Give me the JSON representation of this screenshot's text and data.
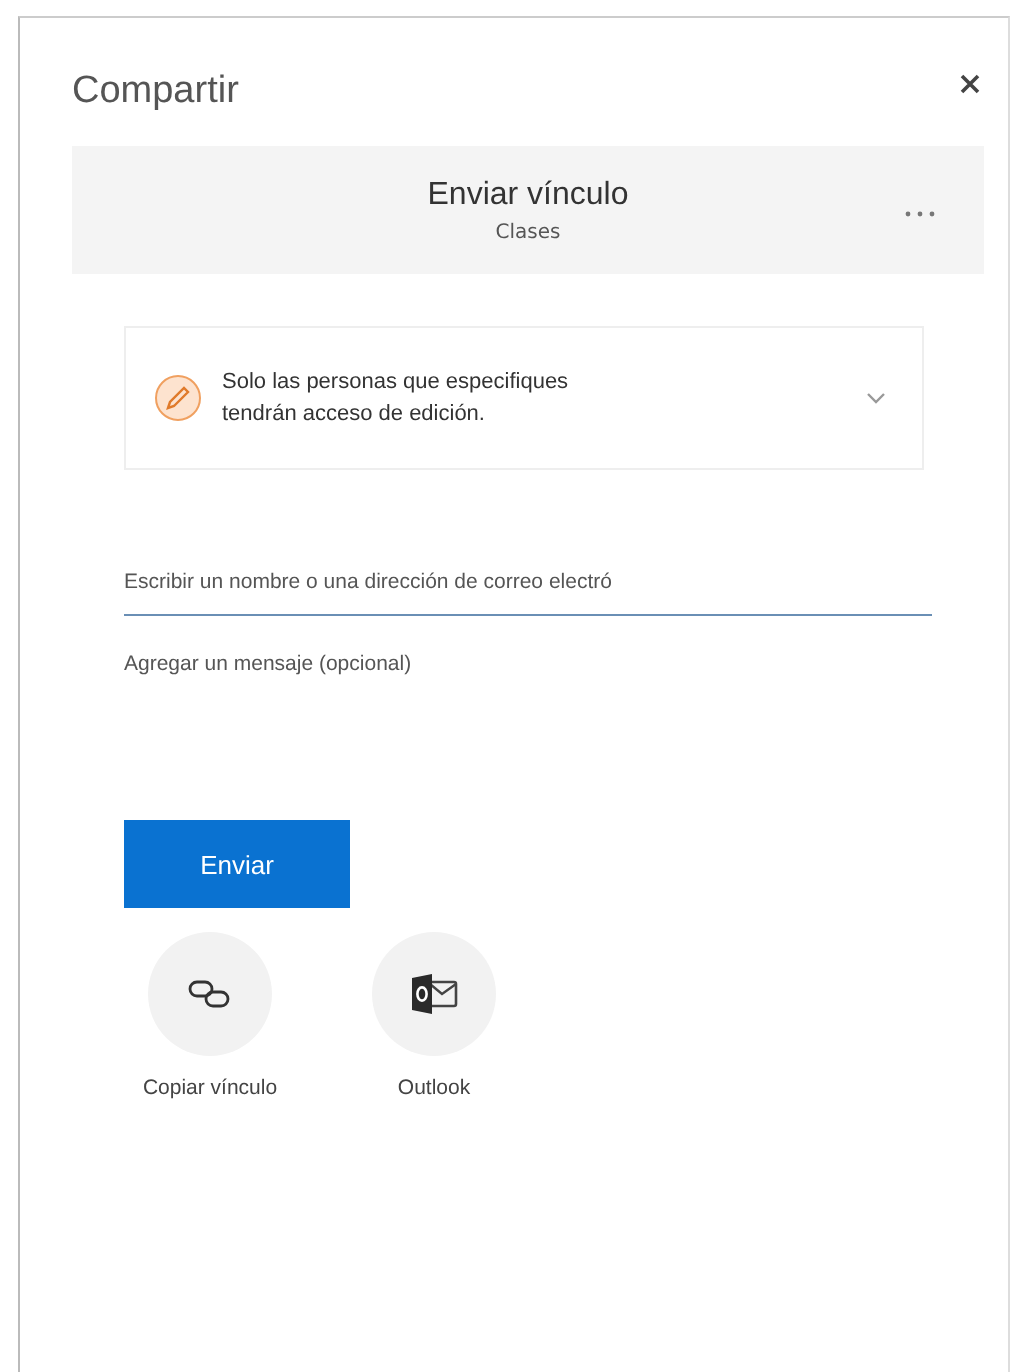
{
  "dialog": {
    "title": "Compartir"
  },
  "header": {
    "title": "Enviar vínculo",
    "subtitle": "Clases"
  },
  "permission": {
    "text": "Solo las personas que especifiques tendrán acceso de edición."
  },
  "recipient": {
    "placeholder": "Escribir un nombre o una dirección de correo electró"
  },
  "message": {
    "placeholder": "Agregar un mensaje (opcional)"
  },
  "send_button": {
    "label": "Enviar"
  },
  "share_targets": [
    {
      "kind": "copy-link",
      "label": "Copiar vínculo"
    },
    {
      "kind": "outlook",
      "label": "Outlook"
    }
  ]
}
